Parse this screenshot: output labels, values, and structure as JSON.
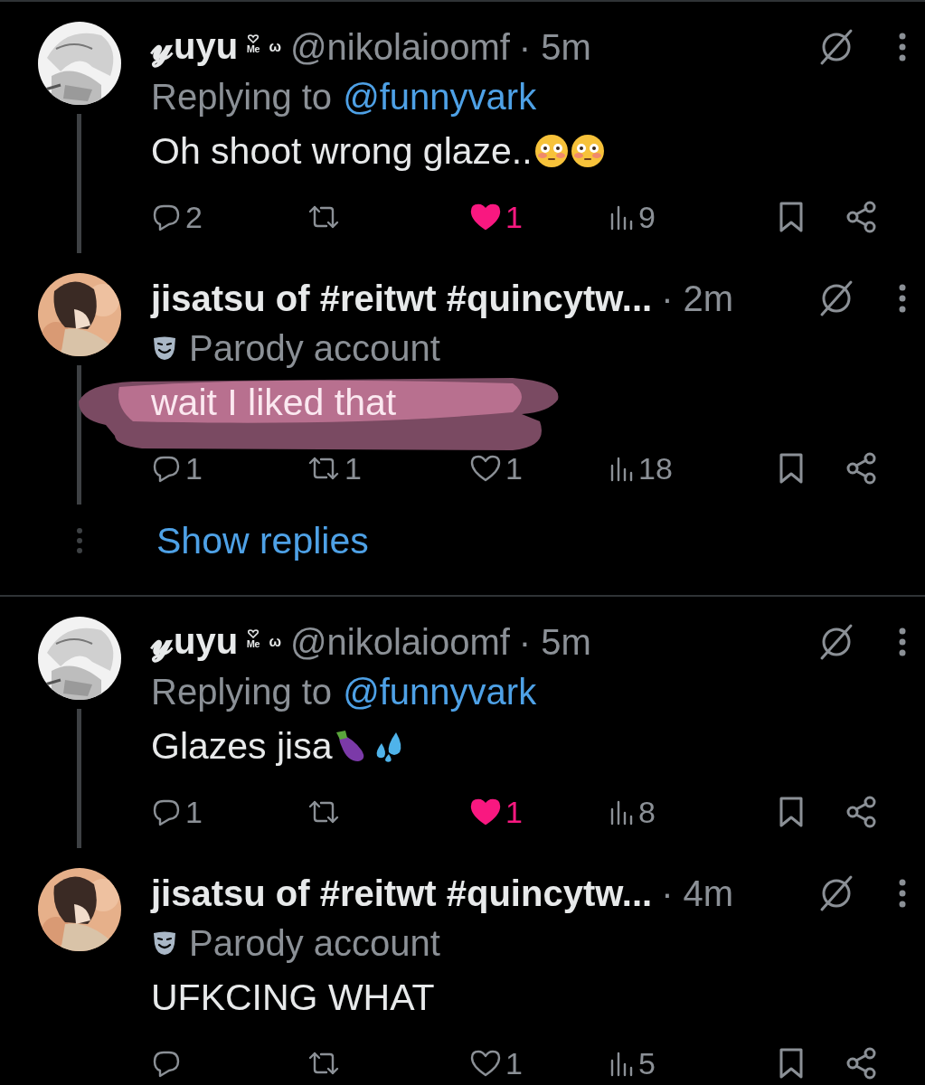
{
  "threads": [
    {
      "tweets": [
        {
          "name": "𝔂uyu",
          "badges": [
            "ᴹᵉ",
            "ω"
          ],
          "handle": "@nikolaioomf",
          "time": "· 5m",
          "reply_prefix": "Replying to",
          "reply_handle": "@funnyvark",
          "text": "Oh shoot wrong glaze..",
          "emojis": [
            {
              "kind": "flushed"
            },
            {
              "kind": "flushed"
            }
          ],
          "replies": "2",
          "likes": "1",
          "liked": true,
          "views": "9"
        },
        {
          "name": "jisatsu of #reitwt #quincytw...",
          "time": "· 2m",
          "parody_label": "Parody account",
          "text": "wait I liked that",
          "scribbled": true,
          "replies": "1",
          "reposts": "1",
          "likes": "1",
          "liked": false,
          "views": "18"
        }
      ],
      "show_replies": "Show replies"
    },
    {
      "tweets": [
        {
          "name": "𝔂uyu",
          "badges": [
            "ᴹᵉ",
            "ω"
          ],
          "handle": "@nikolaioomf",
          "time": "· 5m",
          "reply_prefix": "Replying to",
          "reply_handle": "@funnyvark",
          "text": "Glazes jisa",
          "emojis": [
            {
              "kind": "eggplant"
            },
            {
              "kind": "droplets"
            }
          ],
          "replies": "1",
          "likes": "1",
          "liked": true,
          "views": "8"
        },
        {
          "name": "jisatsu of #reitwt #quincytw...",
          "time": "· 4m",
          "parody_label": "Parody account",
          "text": "UFKCING WHAT",
          "likes": "1",
          "liked": false,
          "views": "5"
        }
      ]
    }
  ]
}
